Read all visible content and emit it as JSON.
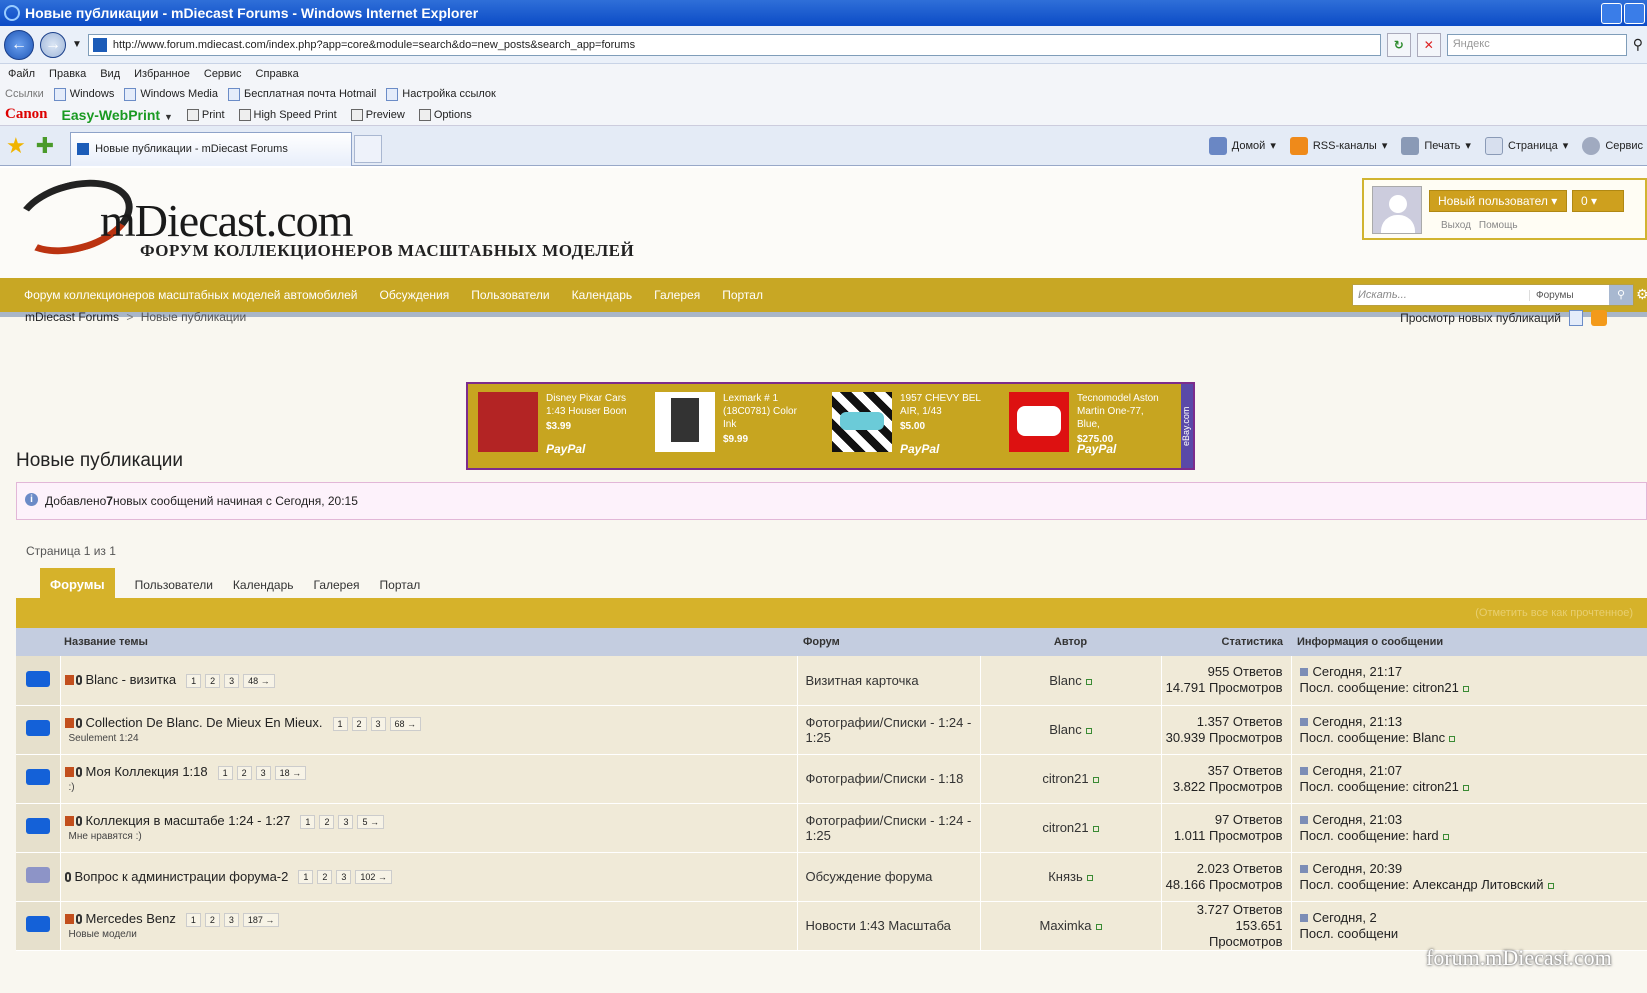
{
  "ie": {
    "title": "Новые публикации - mDiecast Forums - Windows Internet Explorer",
    "url": "http://www.forum.mdiecast.com/index.php?app=core&module=search&do=new_posts&search_app=forums",
    "search_placeholder": "Яндекс",
    "menu": [
      "Файл",
      "Правка",
      "Вид",
      "Избранное",
      "Сервис",
      "Справка"
    ],
    "links_label": "Ссылки",
    "links": [
      "Windows",
      "Windows Media",
      "Бесплатная почта Hotmail",
      "Настройка ссылок"
    ],
    "canon": "Canon",
    "ewp": "Easy-WebPrint",
    "canon_btns": [
      "Print",
      "High Speed Print",
      "Preview",
      "Options"
    ],
    "tab_title": "Новые публикации - mDiecast Forums",
    "cmds": [
      "Домой",
      "RSS-каналы",
      "Печать",
      "Страница",
      "Сервис"
    ]
  },
  "site": {
    "logo": "mDiecast.com",
    "logo_sub": "ФОРУМ КОЛЛЕКЦИОНЕРОВ МАСШТАБНЫХ МОДЕЛЕЙ",
    "user_btn": "Новый пользовател ▾",
    "count_btn": "0 ▾",
    "logout": "Выход",
    "help": "Помощь",
    "nav": [
      "Форум коллекционеров масштабных моделей автомобилей",
      "Обсуждения",
      "Пользователи",
      "Календарь",
      "Галерея",
      "Портал"
    ],
    "search_ph": "Искать...",
    "search_scope": "Форумы"
  },
  "crumbs": {
    "home": "mDiecast Forums",
    "sep": ">",
    "current": "Новые публикации"
  },
  "view_new": "Просмотр новых публикаций",
  "ebay": {
    "vertical": "eBay.com",
    "items": [
      {
        "t1": "Disney Pixar Cars",
        "t2": "1:43 Houser Boon",
        "price": "$3.99",
        "paypal": "PayPal"
      },
      {
        "t1": "Lexmark # 1",
        "t2": "(18C0781) Color Ink",
        "price": "$9.99",
        "paypal": ""
      },
      {
        "t1": "1957 CHEVY BEL",
        "t2": "AIR, 1/43",
        "price": "$5.00",
        "paypal": "PayPal"
      },
      {
        "t1": "Tecnomodel Aston",
        "t2": "Martin One-77, Blue,",
        "price": "$275.00",
        "paypal": "PayPal"
      }
    ]
  },
  "page_title": "Новые публикации",
  "info": {
    "pre": "Добавлено ",
    "count": "7",
    "post": " новых сообщений начиная с Сегодня, 20:15"
  },
  "page_info": "Страница 1 из 1",
  "tabs": [
    "Форумы",
    "Пользователи",
    "Календарь",
    "Галерея",
    "Портал"
  ],
  "mark_all": "(Отметить все как прочтенное)",
  "columns": {
    "topic": "Название темы",
    "forum": "Форум",
    "author": "Автор",
    "stats": "Статистика",
    "info": "Информация о сообщении"
  },
  "rows": [
    {
      "title": "Blanc - визитка",
      "desc": "",
      "pages": [
        "1",
        "2",
        "3",
        "48 →"
      ],
      "forum": "Визитная карточка",
      "author": "Blanc",
      "replies": "955 Ответов",
      "views": "14.791 Просмотров",
      "time": "Сегодня, 21:17",
      "last_label": "Посл. сообщение: ",
      "last_user": "citron21"
    },
    {
      "title": "Collection De Blanc. De Mieux En Mieux.",
      "desc": "Seulement 1:24",
      "pages": [
        "1",
        "2",
        "3",
        "68 →"
      ],
      "forum": "Фотографии/Списки - 1:24 - 1:25",
      "author": "Blanc",
      "replies": "1.357 Ответов",
      "views": "30.939 Просмотров",
      "time": "Сегодня, 21:13",
      "last_label": "Посл. сообщение: ",
      "last_user": "Blanc"
    },
    {
      "title": "Моя Коллекция 1:18",
      "desc": ":)",
      "pages": [
        "1",
        "2",
        "3",
        "18 →"
      ],
      "forum": "Фотографии/Списки - 1:18",
      "author": "citron21",
      "replies": "357 Ответов",
      "views": "3.822 Просмотров",
      "time": "Сегодня, 21:07",
      "last_label": "Посл. сообщение: ",
      "last_user": "citron21"
    },
    {
      "title": "Коллекция в масштабе 1:24 - 1:27",
      "desc": "Мне нравятся :)",
      "pages": [
        "1",
        "2",
        "3",
        "5 →"
      ],
      "forum": "Фотографии/Списки - 1:24 - 1:25",
      "author": "citron21",
      "replies": "97 Ответов",
      "views": "1.011 Просмотров",
      "time": "Сегодня, 21:03",
      "last_label": "Посл. сообщение: ",
      "last_user": "hard"
    },
    {
      "title": "Вопрос к администрации форума-2",
      "desc": "",
      "pages": [
        "1",
        "2",
        "3",
        "102 →"
      ],
      "forum": "Обсуждение форума",
      "author": "Князь",
      "replies": "2.023 Ответов",
      "views": "48.166 Просмотров",
      "time": "Сегодня, 20:39",
      "last_label": "Посл. сообщение: ",
      "last_user": "Александр Литовский"
    },
    {
      "title": "Mercedes Benz",
      "desc": "Новые модели",
      "pages": [
        "1",
        "2",
        "3",
        "187 →"
      ],
      "forum": "Новости 1:43 Масштаба",
      "author": "Maximka",
      "replies": "3.727 Ответов",
      "views": "153.651 Просмотров",
      "time": "Сегодня, 2",
      "last_label": "Посл. сообщени",
      "last_user": ""
    }
  ],
  "watermark": "forum.mDiecast.com"
}
